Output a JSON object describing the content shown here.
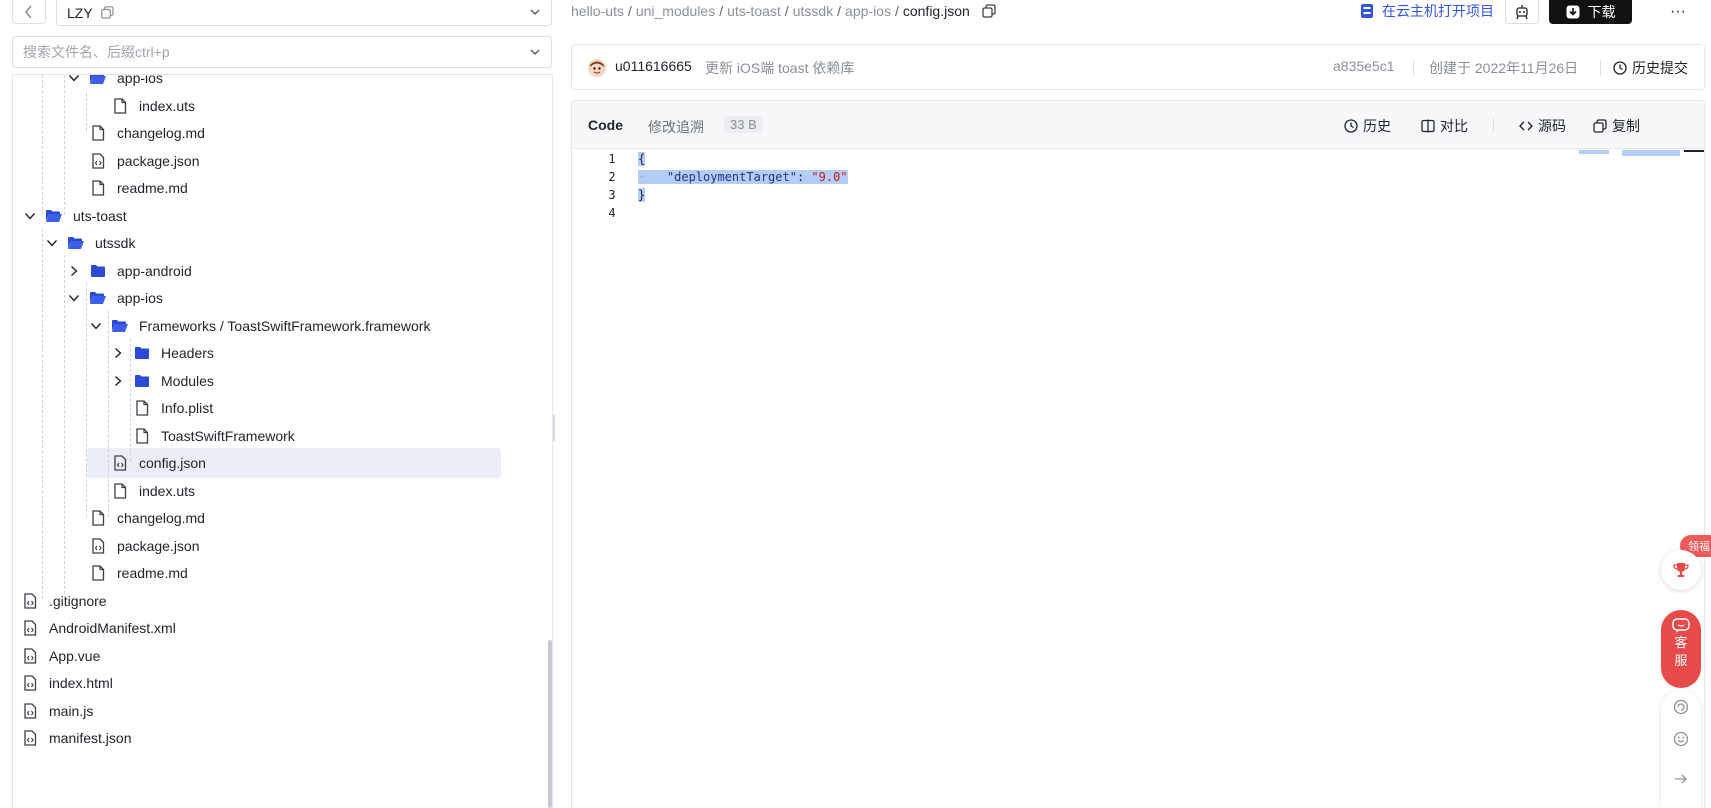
{
  "repo": {
    "name": "LZY"
  },
  "search": {
    "placeholder": "搜索文件名、后缀ctrl+p"
  },
  "tree": {
    "items": [
      {
        "label": "app-ios",
        "type": "folder-open"
      },
      {
        "label": "index.uts",
        "type": "file"
      },
      {
        "label": "changelog.md",
        "type": "file"
      },
      {
        "label": "package.json",
        "type": "file-code"
      },
      {
        "label": "readme.md",
        "type": "file"
      },
      {
        "label": "uts-toast",
        "type": "folder-open"
      },
      {
        "label": "utssdk",
        "type": "folder-open"
      },
      {
        "label": "app-android",
        "type": "folder"
      },
      {
        "label": "app-ios",
        "type": "folder-open"
      },
      {
        "label": "Frameworks / ToastSwiftFramework.framework",
        "type": "folder-open"
      },
      {
        "label": "Headers",
        "type": "folder"
      },
      {
        "label": "Modules",
        "type": "folder"
      },
      {
        "label": "Info.plist",
        "type": "file"
      },
      {
        "label": "ToastSwiftFramework",
        "type": "file"
      },
      {
        "label": "config.json",
        "type": "file-code",
        "selected": true
      },
      {
        "label": "index.uts",
        "type": "file"
      },
      {
        "label": "changelog.md",
        "type": "file"
      },
      {
        "label": "package.json",
        "type": "file-code"
      },
      {
        "label": "readme.md",
        "type": "file"
      },
      {
        "label": ".gitignore",
        "type": "file-code"
      },
      {
        "label": "AndroidManifest.xml",
        "type": "file-code"
      },
      {
        "label": "App.vue",
        "type": "file-code"
      },
      {
        "label": "index.html",
        "type": "file-code"
      },
      {
        "label": "main.js",
        "type": "file-code"
      },
      {
        "label": "manifest.json",
        "type": "file-code"
      }
    ]
  },
  "breadcrumb": [
    "hello-uts",
    "uni_modules",
    "uts-toast",
    "utssdk",
    "app-ios",
    "config.json"
  ],
  "toolbar": {
    "open_cloud_label": "在云主机打开项目",
    "download_label": "下载",
    "more_label": "···"
  },
  "commit": {
    "user": "u011616665",
    "message": "更新 iOS端 toast 依赖库",
    "hash": "a835e5c1",
    "created": "创建于 2022年11月26日",
    "history_label": "历史提交"
  },
  "code": {
    "tab_code": "Code",
    "tab_blame": "修改追溯",
    "size": "33 B",
    "actions": {
      "history": "历史",
      "compare": "对比",
      "source": "源码",
      "copy": "复制"
    },
    "lines": [
      {
        "n": "1",
        "open": "{"
      },
      {
        "n": "2",
        "key": "\"deploymentTarget\"",
        "colon": ": ",
        "val": "\"9.0\""
      },
      {
        "n": "3",
        "close": "}"
      },
      {
        "n": "4"
      }
    ]
  },
  "widgets": {
    "gift_label": "领福",
    "service_label_1": "客",
    "service_label_2": "服"
  },
  "colors": {
    "accent": "#3355e0",
    "selection": "#b4cdf6",
    "folder": "#2b4bd6",
    "service": "#e84a4a"
  }
}
